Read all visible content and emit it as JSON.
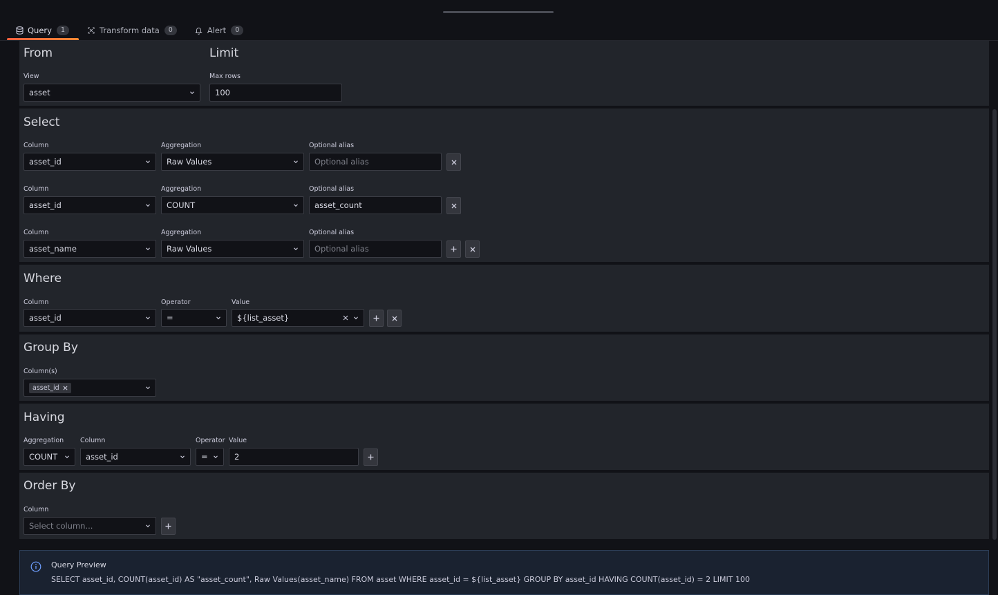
{
  "tabs": [
    {
      "label": "Query",
      "count": "1",
      "icon": "database-icon"
    },
    {
      "label": "Transform data",
      "count": "0",
      "icon": "transform-icon"
    },
    {
      "label": "Alert",
      "count": "0",
      "icon": "bell-icon"
    }
  ],
  "from": {
    "title": "From",
    "view_label": "View",
    "view_value": "asset"
  },
  "limit": {
    "title": "Limit",
    "max_rows_label": "Max rows",
    "max_rows_value": "100"
  },
  "select": {
    "title": "Select",
    "column_label": "Column",
    "aggregation_label": "Aggregation",
    "alias_label": "Optional alias",
    "alias_placeholder": "Optional alias",
    "rows": [
      {
        "column": "asset_id",
        "aggregation": "Raw Values",
        "alias": ""
      },
      {
        "column": "asset_id",
        "aggregation": "COUNT",
        "alias": "asset_count"
      },
      {
        "column": "asset_name",
        "aggregation": "Raw Values",
        "alias": ""
      }
    ]
  },
  "where": {
    "title": "Where",
    "column_label": "Column",
    "column_value": "asset_id",
    "operator_label": "Operator",
    "operator_value": "=",
    "value_label": "Value",
    "value_value": "${list_asset}"
  },
  "group_by": {
    "title": "Group By",
    "columns_label": "Column(s)",
    "chip": "asset_id"
  },
  "having": {
    "title": "Having",
    "aggregation_label": "Aggregation",
    "aggregation_value": "COUNT",
    "column_label": "Column",
    "column_value": "asset_id",
    "operator_label": "Operator",
    "operator_value": "=",
    "value_label": "Value",
    "value_value": "2"
  },
  "order_by": {
    "title": "Order By",
    "column_label": "Column",
    "column_placeholder": "Select column..."
  },
  "preview": {
    "title": "Query Preview",
    "sql": "SELECT asset_id, COUNT(asset_id) AS \"asset_count\", Raw Values(asset_name) FROM asset WHERE asset_id = ${list_asset} GROUP BY asset_id HAVING COUNT(asset_id) = 2 LIMIT 100"
  },
  "colors": {
    "accent": "#f55f3e",
    "panel": "#22252b",
    "background": "#111217",
    "info": "#6e9fff"
  }
}
